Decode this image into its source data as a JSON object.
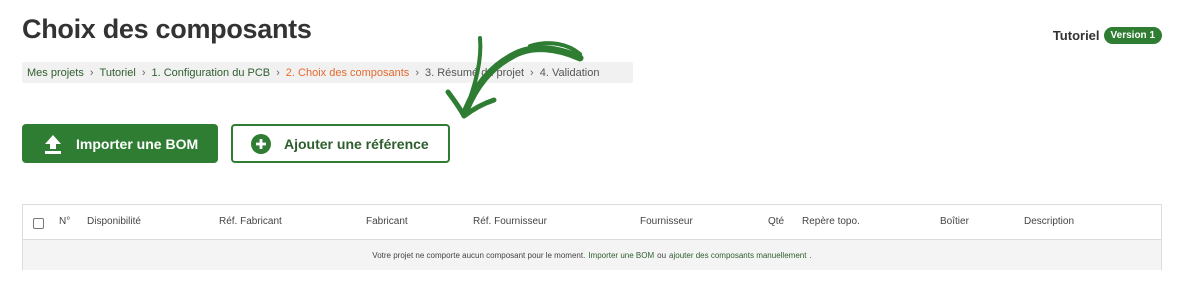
{
  "header": {
    "title": "Choix des composants",
    "project_name": "Tutoriel",
    "version_badge": "Version 1"
  },
  "breadcrumb": [
    {
      "label": "Mes projets",
      "state": "link"
    },
    {
      "label": "Tutoriel",
      "state": "link"
    },
    {
      "label": "1. Configuration du PCB",
      "state": "link"
    },
    {
      "label": "2. Choix des composants",
      "state": "active"
    },
    {
      "label": "3. Résumé du projet",
      "state": "future"
    },
    {
      "label": "4. Validation",
      "state": "future"
    }
  ],
  "breadcrumb_separator": "›",
  "actions": {
    "import_label": "Importer une BOM",
    "import_icon": "upload-icon",
    "add_label": "Ajouter une référence",
    "add_icon": "plus-circle-icon"
  },
  "table": {
    "columns": [
      "N°",
      "Disponibilité",
      "Réf. Fabricant",
      "Fabricant",
      "Réf. Fournisseur",
      "Fournisseur",
      "Qté",
      "Repère topo.",
      "Boîtier",
      "Description"
    ],
    "empty_message_text": "Votre projet ne comporte aucun composant pour le moment.",
    "empty_link_import": "Importer une BOM",
    "empty_message_or": "ou",
    "empty_link_add": "ajouter des composants manuellement",
    "empty_message_end": "."
  },
  "colors": {
    "accent_green": "#2e7d32",
    "active_step": "#e46a2e"
  }
}
